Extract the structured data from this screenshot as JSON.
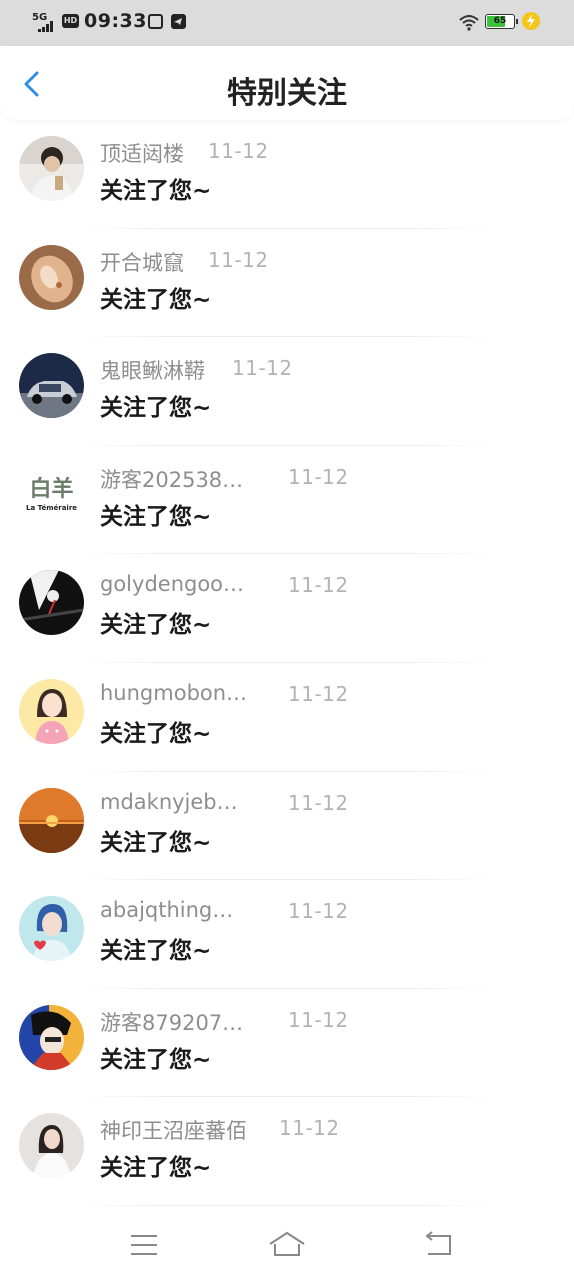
{
  "status_bar": {
    "network": "5G",
    "hd": "HD",
    "time": "09:33",
    "battery": "65",
    "battery_fraction": 0.65,
    "icons": [
      "signal-icon",
      "hd-icon",
      "pay-app-icon",
      "telegram-icon",
      "wifi-icon",
      "battery-icon",
      "charging-icon"
    ]
  },
  "header": {
    "title": "特别关注",
    "back_icon": "chevron-left-icon",
    "accent": "#2f8ee6"
  },
  "items": [
    {
      "name": "顶适闼楼",
      "date": "11-12",
      "message": "关注了您~",
      "avatar": "photo-person"
    },
    {
      "name": "开合城竄",
      "date": "11-12",
      "message": "关注了您~",
      "avatar": "photo-shell"
    },
    {
      "name": "鬼眼鳅淋鞯",
      "date": "11-12",
      "message": "关注了您~",
      "avatar": "photo-car"
    },
    {
      "name": "游客202538…",
      "date": "11-12",
      "message": "关注了您~",
      "avatar": "logo-baiyang"
    },
    {
      "name": "golydengoo…",
      "date": "11-12",
      "message": "关注了您~",
      "avatar": "illustration-dark"
    },
    {
      "name": "hungmobon…",
      "date": "11-12",
      "message": "关注了您~",
      "avatar": "illustration-girl"
    },
    {
      "name": "mdaknyjeb…",
      "date": "11-12",
      "message": "关注了您~",
      "avatar": "photo-sunset"
    },
    {
      "name": "abajqthing…",
      "date": "11-12",
      "message": "关注了您~",
      "avatar": "illustration-blue"
    },
    {
      "name": "游客879207…",
      "date": "11-12",
      "message": "关注了您~",
      "avatar": "illustration-colorful"
    },
    {
      "name": "神印王沼座蕃佰",
      "date": "11-12",
      "message": "关注了您~",
      "avatar": "photo-woman"
    }
  ],
  "baiyang_logo": {
    "big": "白羊",
    "small": "La Téméraire"
  },
  "bottom_nav": {
    "menu_icon": "menu-icon",
    "home_icon": "home-icon",
    "back_icon": "return-icon"
  }
}
